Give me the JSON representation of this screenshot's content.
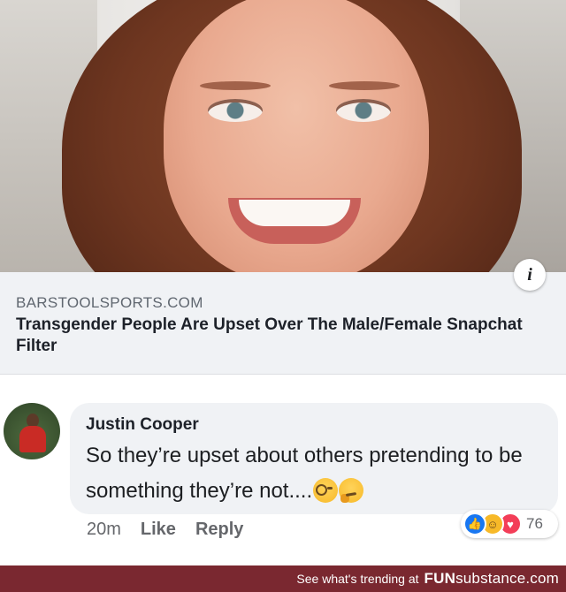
{
  "link_preview": {
    "info_icon": "info-icon",
    "domain": "BARSTOOLSPORTS.COM",
    "title": "Transgender People Are Upset Over The Male/Female Snapchat Filter"
  },
  "comment": {
    "author": "Justin Cooper",
    "text": "So they’re upset about others pretending to be something they’re not....",
    "emojis": [
      "face-with-monocle-icon",
      "thinking-face-icon"
    ],
    "time": "20m",
    "like_label": "Like",
    "reply_label": "Reply",
    "reactions": {
      "icons": [
        "like-icon",
        "haha-icon",
        "love-icon"
      ],
      "count": "76"
    }
  },
  "footer": {
    "tagline": "See what's trending at",
    "brand_bold": "FUN",
    "brand_light": "substance",
    "brand_suffix": ".com"
  },
  "colors": {
    "facebook_blue": "#1877f2",
    "card_gray": "#f0f2f5",
    "footer_bar": "#7a2830"
  }
}
